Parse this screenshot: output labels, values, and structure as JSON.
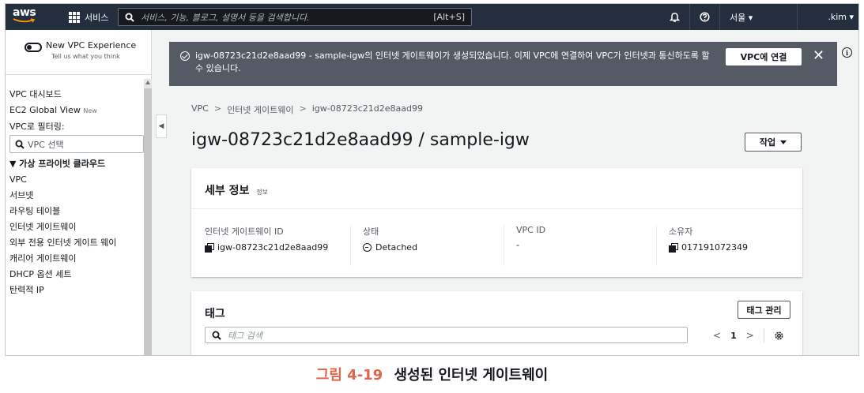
{
  "nav": {
    "logo": "aws",
    "services": "서비스",
    "search_placeholder": "서비스, 기능, 블로그, 설명서 등을 검색합니다.",
    "search_shortcut": "[Alt+S]",
    "region": "서울 ▾",
    "user": ".kim ▾",
    "icons": [
      "bell-icon",
      "help-icon"
    ]
  },
  "sidebar": {
    "new_vpc_title": "New VPC Experience",
    "new_vpc_sub": "Tell us what you think",
    "items_top": [
      "VPC 대시보드",
      "EC2 Global View"
    ],
    "new_badge": "New",
    "filter_label": "VPC로 필터링:",
    "filter_placeholder": "VPC 선택",
    "group": "▼ 가상 프라이빗 클라우드",
    "items": [
      "VPC",
      "서브넷",
      "라우팅 테이블",
      "인터넷 게이트웨이",
      "외부 전용 인터넷 게이트 웨이",
      "캐리어 게이트웨이",
      "DHCP 옵션 세트",
      "탄력적 IP"
    ]
  },
  "flash": {
    "message": "igw-08723c21d2e8aad99 - sample-igw의 인터넷 게이트웨이가 생성되었습니다. 이제 VPC에 연결하여 VPC가 인터넷과 통신하도록 할 수 있습니다.",
    "button": "VPC에 연결",
    "close": "✕"
  },
  "breadcrumb": {
    "items": [
      "VPC",
      "인터넷 게이트웨이",
      "igw-08723c21d2e8aad99"
    ]
  },
  "page": {
    "title": "igw-08723c21d2e8aad99 / sample-igw",
    "action": "작업"
  },
  "details": {
    "heading": "세부 정보",
    "info": "정보",
    "fields": [
      {
        "label": "인터넷 게이트웨이 ID",
        "value": "igw-08723c21d2e8aad99"
      },
      {
        "label": "상태",
        "value": "Detached"
      },
      {
        "label": "VPC ID",
        "value": "-"
      },
      {
        "label": "소유자",
        "value": "017191072349"
      }
    ]
  },
  "tags": {
    "heading": "태그",
    "manage": "태그 관리",
    "search_placeholder": "태그 검색",
    "page": "1"
  },
  "caption": {
    "number": "그림 4-19",
    "text": "생성된 인터넷 게이트웨이"
  },
  "colors": {
    "nav_bg": "#232f3e",
    "flash_bg": "#545b64",
    "caption_accent": "#e0654b"
  }
}
